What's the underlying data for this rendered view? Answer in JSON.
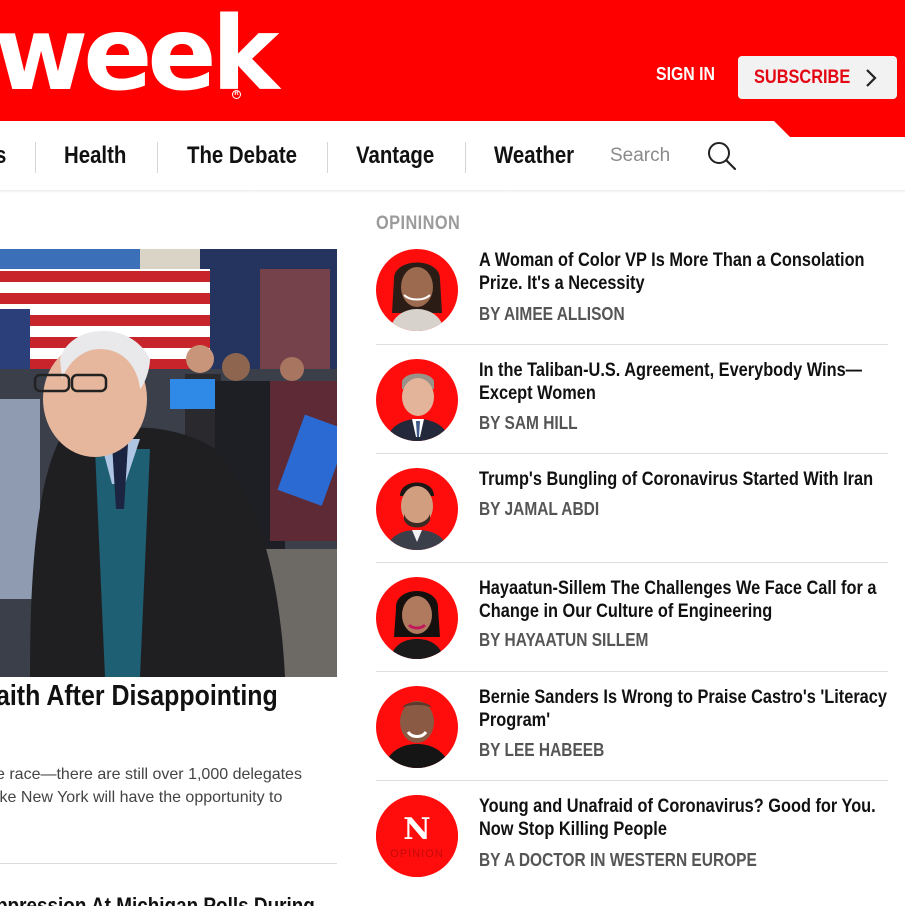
{
  "header": {
    "logo_text": "week",
    "logo_mark": "R",
    "sign_in_label": "SIGN IN",
    "subscribe_label": "SUBSCRIBE",
    "brand_color": "#ff0000"
  },
  "nav": {
    "items": [
      {
        "label": "s"
      },
      {
        "label": "Health"
      },
      {
        "label": "The Debate"
      },
      {
        "label": "Vantage"
      },
      {
        "label": "Weather"
      }
    ],
    "search_placeholder": "Search"
  },
  "hero": {
    "headline": "aith After Disappointing",
    "summary_lines": [
      "e race—there are still over 1,000 delegates",
      "ike New York will have the opportunity to"
    ],
    "next_headline": "ppression At Michigan Polls During"
  },
  "opinion": {
    "heading": "OPININON",
    "items": [
      {
        "title_lines": [
          "A Woman of Color VP Is More Than a Consolation",
          "Prize. It's a Necessity"
        ],
        "byline": "BY AIMEE ALLISON"
      },
      {
        "title_lines": [
          "In the Taliban-U.S. Agreement, Everybody Wins—",
          "Except Women"
        ],
        "byline": "BY SAM HILL"
      },
      {
        "title_lines": [
          "Trump's Bungling of Coronavirus Started With Iran"
        ],
        "byline": "BY JAMAL ABDI"
      },
      {
        "title_lines": [
          "Hayaatun-Sillem The Challenges We Face Call for a",
          "Change in Our Culture of Engineering"
        ],
        "byline": "BY HAYAATUN SILLEM"
      },
      {
        "title_lines": [
          "Bernie Sanders Is Wrong to Praise Castro's 'Literacy",
          "Program'"
        ],
        "byline": "BY LEE HABEEB"
      },
      {
        "title_lines": [
          "Young and Unafraid of Coronavirus? Good for You.",
          "Now Stop Killing People"
        ],
        "byline": "BY A DOCTOR IN WESTERN EUROPE",
        "badge_letter": "N",
        "badge_word": "OPINION"
      }
    ]
  }
}
